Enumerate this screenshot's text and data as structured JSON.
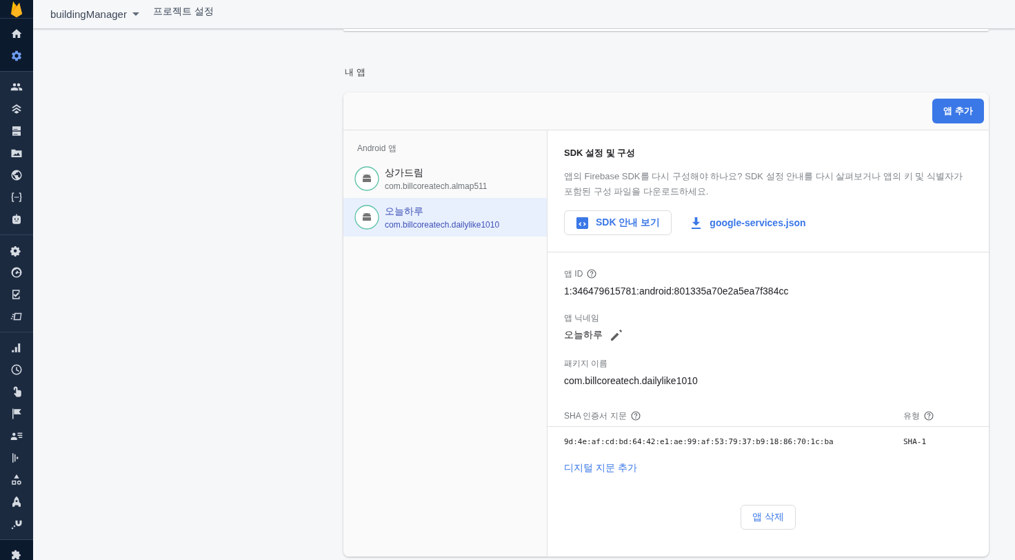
{
  "top_bar": {
    "project": "buildingManager",
    "page_title": "프로젝트 설정"
  },
  "sidebar": {
    "groups": [
      {
        "items": [
          {
            "kind": "home",
            "selected": false
          },
          {
            "kind": "settings",
            "selected": true
          }
        ]
      },
      {
        "items": [
          {
            "kind": "people",
            "selected": false
          },
          {
            "kind": "layers",
            "selected": false
          },
          {
            "kind": "server",
            "selected": false
          },
          {
            "kind": "folder",
            "selected": false
          },
          {
            "kind": "globe",
            "selected": false
          },
          {
            "kind": "braces",
            "selected": false
          },
          {
            "kind": "robot",
            "selected": false
          }
        ]
      },
      {
        "items": [
          {
            "kind": "gears",
            "selected": false
          },
          {
            "kind": "gauge",
            "selected": false
          },
          {
            "kind": "checklist",
            "selected": false
          },
          {
            "kind": "card",
            "selected": false
          }
        ]
      },
      {
        "items": [
          {
            "kind": "chart",
            "selected": false
          },
          {
            "kind": "clock",
            "selected": false
          },
          {
            "kind": "touch",
            "selected": false
          },
          {
            "kind": "flag",
            "selected": false
          },
          {
            "kind": "userlist",
            "selected": false
          },
          {
            "kind": "bars",
            "selected": false
          },
          {
            "kind": "shapes",
            "selected": false
          },
          {
            "kind": "rocket",
            "selected": false
          },
          {
            "kind": "magnet",
            "selected": false
          }
        ]
      },
      {
        "items": [
          {
            "kind": "puzzle",
            "selected": false
          }
        ]
      }
    ]
  },
  "section_title": "내 앱",
  "add_app_button": "앱 추가",
  "app_list": {
    "heading": "Android 앱",
    "apps": [
      {
        "name": "상가드림",
        "package": "com.billcoreatech.almap511",
        "selected": false
      },
      {
        "name": "오늘하루",
        "package": "com.billcoreatech.dailylike1010",
        "selected": true
      }
    ]
  },
  "sdk": {
    "title": "SDK 설정 및 구성",
    "description": "앱의 Firebase SDK를 다시 구성해야 하나요? SDK 설정 안내를 다시 살펴보거나 앱의 키 및 식별자가 포함된 구성 파일을 다운로드하세요.",
    "guide_button": "SDK 안내 보기",
    "download_link": "google-services.json"
  },
  "details": {
    "app_id_label": "앱 ID",
    "app_id": "1:346479615781:android:801335a70e2a5ea7f384cc",
    "nickname_label": "앱 닉네임",
    "nickname": "오늘하루",
    "package_label": "패키지 이름",
    "package": "com.billcoreatech.dailylike1010"
  },
  "fingerprints": {
    "columns": [
      "SHA 인증서 지문",
      "유형"
    ],
    "rows": [
      {
        "fingerprint": "9d:4e:af:cd:bd:64:42:e1:ae:99:af:53:79:37:b9:18:86:70:1c:ba",
        "type": "SHA-1"
      }
    ],
    "add_link": "디지털 지문 추가"
  },
  "delete_button": "앱 삭제"
}
